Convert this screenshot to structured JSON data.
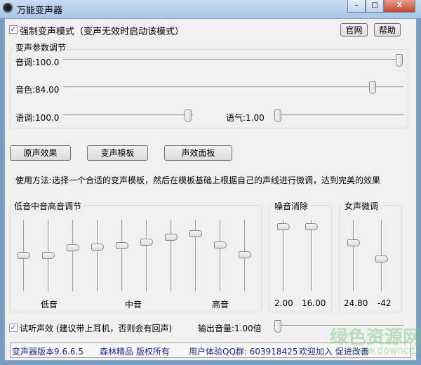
{
  "window": {
    "title": "万能变声器",
    "minimize": "–",
    "maximize": "□",
    "close": "X"
  },
  "force_mode": {
    "label": "强制变声模式（变声无效时启动该模式）",
    "checked": true
  },
  "top_buttons": {
    "website": "官网",
    "help": "帮助"
  },
  "params": {
    "title": "变声参数调节",
    "pitch": {
      "label": "音调:100.0",
      "value": 100,
      "max": 100
    },
    "timbre": {
      "label": "音色:84.00",
      "value": 84,
      "max": 100
    },
    "speed": {
      "label": "语调:100.0",
      "value": 100,
      "max": 100
    },
    "tone": {
      "label": "语气:1.00",
      "value": 0,
      "max": 100
    }
  },
  "buttons": {
    "original": "原声效果",
    "templates": "变声模板",
    "effects": "声效面板"
  },
  "usage": "使用方法:选择一个合适的变声模板，然后在模板基础上根据自己的声线进行微调，达到完美的效果",
  "eq": {
    "title": "低音中音高音调节",
    "labels": [
      "低音",
      "中音",
      "高音"
    ],
    "levels": [
      0.5,
      0.5,
      0.62,
      0.63,
      0.65,
      0.71,
      0.78,
      0.84,
      0.66,
      0.51
    ]
  },
  "noise": {
    "title": "噪音消除",
    "values": [
      "2.00",
      "16.00"
    ],
    "levels": [
      0.95,
      0.95
    ]
  },
  "female": {
    "title": "女声微调",
    "values": [
      "24.80",
      "-42"
    ],
    "levels": [
      0.7,
      0.45
    ]
  },
  "preview": {
    "label": "试听声效 (建议带上耳机，否则会有回声)",
    "checked": true
  },
  "output": {
    "label": "输出音量:1.00倍",
    "level": 0.0
  },
  "status": {
    "version": "变声器版本9.6.6.5",
    "copyright": "森林精品 版权所有",
    "qq": "用户体验QQ群: 603918425",
    "join": "欢迎加入 促进改善"
  },
  "watermark": {
    "text": "绿色资源网",
    "url": "www.downcc.com"
  }
}
